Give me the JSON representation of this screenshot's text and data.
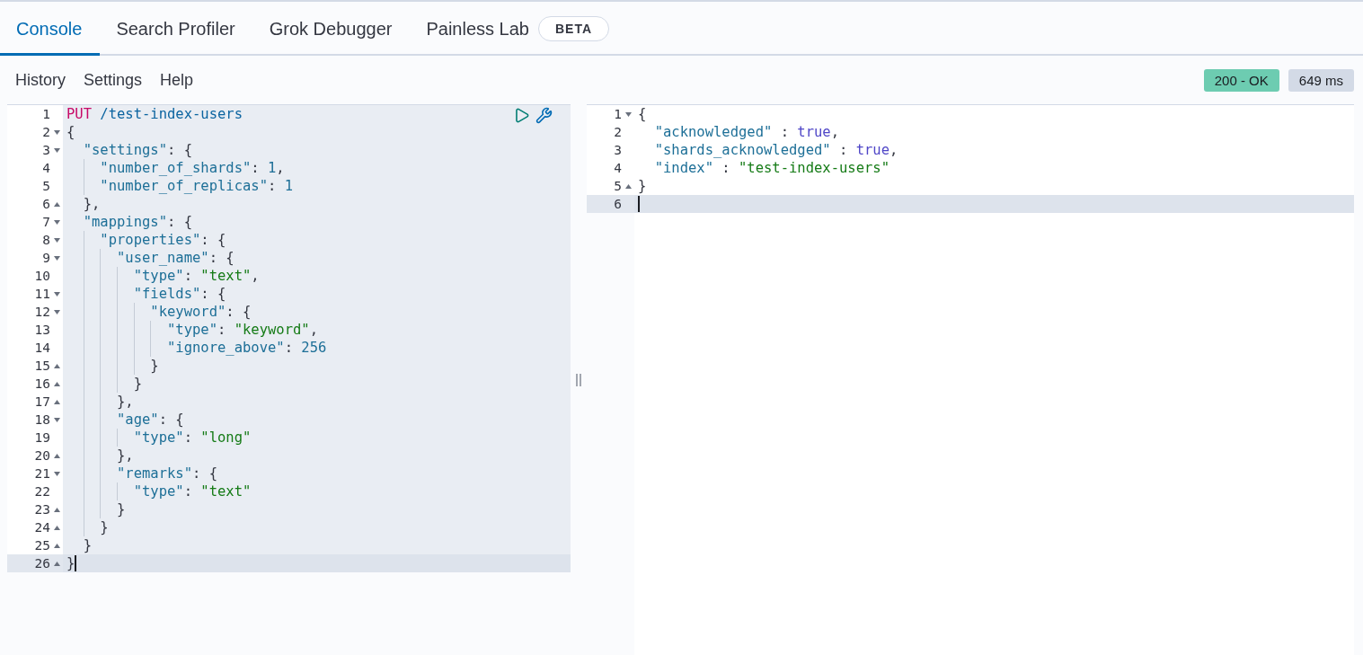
{
  "tabs": [
    {
      "label": "Console",
      "selected": true
    },
    {
      "label": "Search Profiler",
      "selected": false
    },
    {
      "label": "Grok Debugger",
      "selected": false
    },
    {
      "label": "Painless Lab",
      "selected": false,
      "badge": "BETA"
    }
  ],
  "menu": [
    "History",
    "Settings",
    "Help"
  ],
  "status": {
    "code": "200 - OK",
    "time": "649 ms"
  },
  "request_editor": {
    "request_selected": true,
    "lines": [
      {
        "number": "1",
        "kind": "plain",
        "active": false,
        "tokens": [
          {
            "kind": "method",
            "text": "PUT"
          },
          {
            "kind": "path",
            "text": " /test-index-users"
          }
        ]
      },
      {
        "number": "2",
        "kind": "open",
        "active": false,
        "tokens": [
          {
            "kind": "punct",
            "text": "{"
          }
        ]
      },
      {
        "number": "3",
        "kind": "open",
        "active": false,
        "tokens": [
          {
            "kind": "key",
            "text": "  \"settings\""
          },
          {
            "kind": "punct",
            "text": ": {"
          }
        ]
      },
      {
        "number": "4",
        "kind": "plain",
        "active": false,
        "tokens": [
          {
            "kind": "key",
            "text": "    \"number_of_shards\""
          },
          {
            "kind": "punct",
            "text": ": "
          },
          {
            "kind": "number",
            "text": "1"
          },
          {
            "kind": "punct",
            "text": ","
          }
        ]
      },
      {
        "number": "5",
        "kind": "plain",
        "active": false,
        "tokens": [
          {
            "kind": "key",
            "text": "    \"number_of_replicas\""
          },
          {
            "kind": "punct",
            "text": ": "
          },
          {
            "kind": "number",
            "text": "1"
          }
        ]
      },
      {
        "number": "6",
        "kind": "close",
        "active": false,
        "tokens": [
          {
            "kind": "punct",
            "text": "  },"
          }
        ]
      },
      {
        "number": "7",
        "kind": "open",
        "active": false,
        "tokens": [
          {
            "kind": "key",
            "text": "  \"mappings\""
          },
          {
            "kind": "punct",
            "text": ": {"
          }
        ]
      },
      {
        "number": "8",
        "kind": "open",
        "active": false,
        "tokens": [
          {
            "kind": "key",
            "text": "    \"properties\""
          },
          {
            "kind": "punct",
            "text": ": {"
          }
        ]
      },
      {
        "number": "9",
        "kind": "open",
        "active": false,
        "tokens": [
          {
            "kind": "key",
            "text": "      \"user_name\""
          },
          {
            "kind": "punct",
            "text": ": {"
          }
        ]
      },
      {
        "number": "10",
        "kind": "plain",
        "active": false,
        "tokens": [
          {
            "kind": "key",
            "text": "        \"type\""
          },
          {
            "kind": "punct",
            "text": ": "
          },
          {
            "kind": "string",
            "text": "\"text\""
          },
          {
            "kind": "punct",
            "text": ","
          }
        ]
      },
      {
        "number": "11",
        "kind": "open",
        "active": false,
        "tokens": [
          {
            "kind": "key",
            "text": "        \"fields\""
          },
          {
            "kind": "punct",
            "text": ": {"
          }
        ]
      },
      {
        "number": "12",
        "kind": "open",
        "active": false,
        "tokens": [
          {
            "kind": "key",
            "text": "          \"keyword\""
          },
          {
            "kind": "punct",
            "text": ": {"
          }
        ]
      },
      {
        "number": "13",
        "kind": "plain",
        "active": false,
        "tokens": [
          {
            "kind": "key",
            "text": "            \"type\""
          },
          {
            "kind": "punct",
            "text": ": "
          },
          {
            "kind": "string",
            "text": "\"keyword\""
          },
          {
            "kind": "punct",
            "text": ","
          }
        ]
      },
      {
        "number": "14",
        "kind": "plain",
        "active": false,
        "tokens": [
          {
            "kind": "key",
            "text": "            \"ignore_above\""
          },
          {
            "kind": "punct",
            "text": ": "
          },
          {
            "kind": "number",
            "text": "256"
          }
        ]
      },
      {
        "number": "15",
        "kind": "close",
        "active": false,
        "tokens": [
          {
            "kind": "punct",
            "text": "          }"
          }
        ]
      },
      {
        "number": "16",
        "kind": "close",
        "active": false,
        "tokens": [
          {
            "kind": "punct",
            "text": "        }"
          }
        ]
      },
      {
        "number": "17",
        "kind": "close",
        "active": false,
        "tokens": [
          {
            "kind": "punct",
            "text": "      },"
          }
        ]
      },
      {
        "number": "18",
        "kind": "open",
        "active": false,
        "tokens": [
          {
            "kind": "key",
            "text": "      \"age\""
          },
          {
            "kind": "punct",
            "text": ": {"
          }
        ]
      },
      {
        "number": "19",
        "kind": "plain",
        "active": false,
        "tokens": [
          {
            "kind": "key",
            "text": "        \"type\""
          },
          {
            "kind": "punct",
            "text": ": "
          },
          {
            "kind": "string",
            "text": "\"long\""
          }
        ]
      },
      {
        "number": "20",
        "kind": "close",
        "active": false,
        "tokens": [
          {
            "kind": "punct",
            "text": "      },"
          }
        ]
      },
      {
        "number": "21",
        "kind": "open",
        "active": false,
        "tokens": [
          {
            "kind": "key",
            "text": "      \"remarks\""
          },
          {
            "kind": "punct",
            "text": ": {"
          }
        ]
      },
      {
        "number": "22",
        "kind": "plain",
        "active": false,
        "tokens": [
          {
            "kind": "key",
            "text": "        \"type\""
          },
          {
            "kind": "punct",
            "text": ": "
          },
          {
            "kind": "string",
            "text": "\"text\""
          }
        ]
      },
      {
        "number": "23",
        "kind": "close",
        "active": false,
        "tokens": [
          {
            "kind": "punct",
            "text": "      }"
          }
        ]
      },
      {
        "number": "24",
        "kind": "close",
        "active": false,
        "tokens": [
          {
            "kind": "punct",
            "text": "    }"
          }
        ]
      },
      {
        "number": "25",
        "kind": "close",
        "active": false,
        "tokens": [
          {
            "kind": "punct",
            "text": "  }"
          }
        ]
      },
      {
        "number": "26",
        "kind": "close",
        "active": true,
        "tokens": [
          {
            "kind": "punct",
            "text": "}"
          }
        ]
      }
    ]
  },
  "response_editor": {
    "request_selected": false,
    "lines": [
      {
        "number": "1",
        "kind": "open",
        "active": false,
        "tokens": [
          {
            "kind": "punct",
            "text": "{"
          }
        ]
      },
      {
        "number": "2",
        "kind": "plain",
        "active": false,
        "tokens": [
          {
            "kind": "key",
            "text": "  \"acknowledged\""
          },
          {
            "kind": "punct",
            "text": " : "
          },
          {
            "kind": "bool",
            "text": "true"
          },
          {
            "kind": "punct",
            "text": ","
          }
        ]
      },
      {
        "number": "3",
        "kind": "plain",
        "active": false,
        "tokens": [
          {
            "kind": "key",
            "text": "  \"shards_acknowledged\""
          },
          {
            "kind": "punct",
            "text": " : "
          },
          {
            "kind": "bool",
            "text": "true"
          },
          {
            "kind": "punct",
            "text": ","
          }
        ]
      },
      {
        "number": "4",
        "kind": "plain",
        "active": false,
        "tokens": [
          {
            "kind": "key",
            "text": "  \"index\""
          },
          {
            "kind": "punct",
            "text": " : "
          },
          {
            "kind": "string",
            "text": "\"test-index-users\""
          }
        ]
      },
      {
        "number": "5",
        "kind": "close",
        "active": false,
        "tokens": [
          {
            "kind": "punct",
            "text": "}"
          }
        ]
      },
      {
        "number": "6",
        "kind": "plain",
        "active": true
      }
    ]
  }
}
